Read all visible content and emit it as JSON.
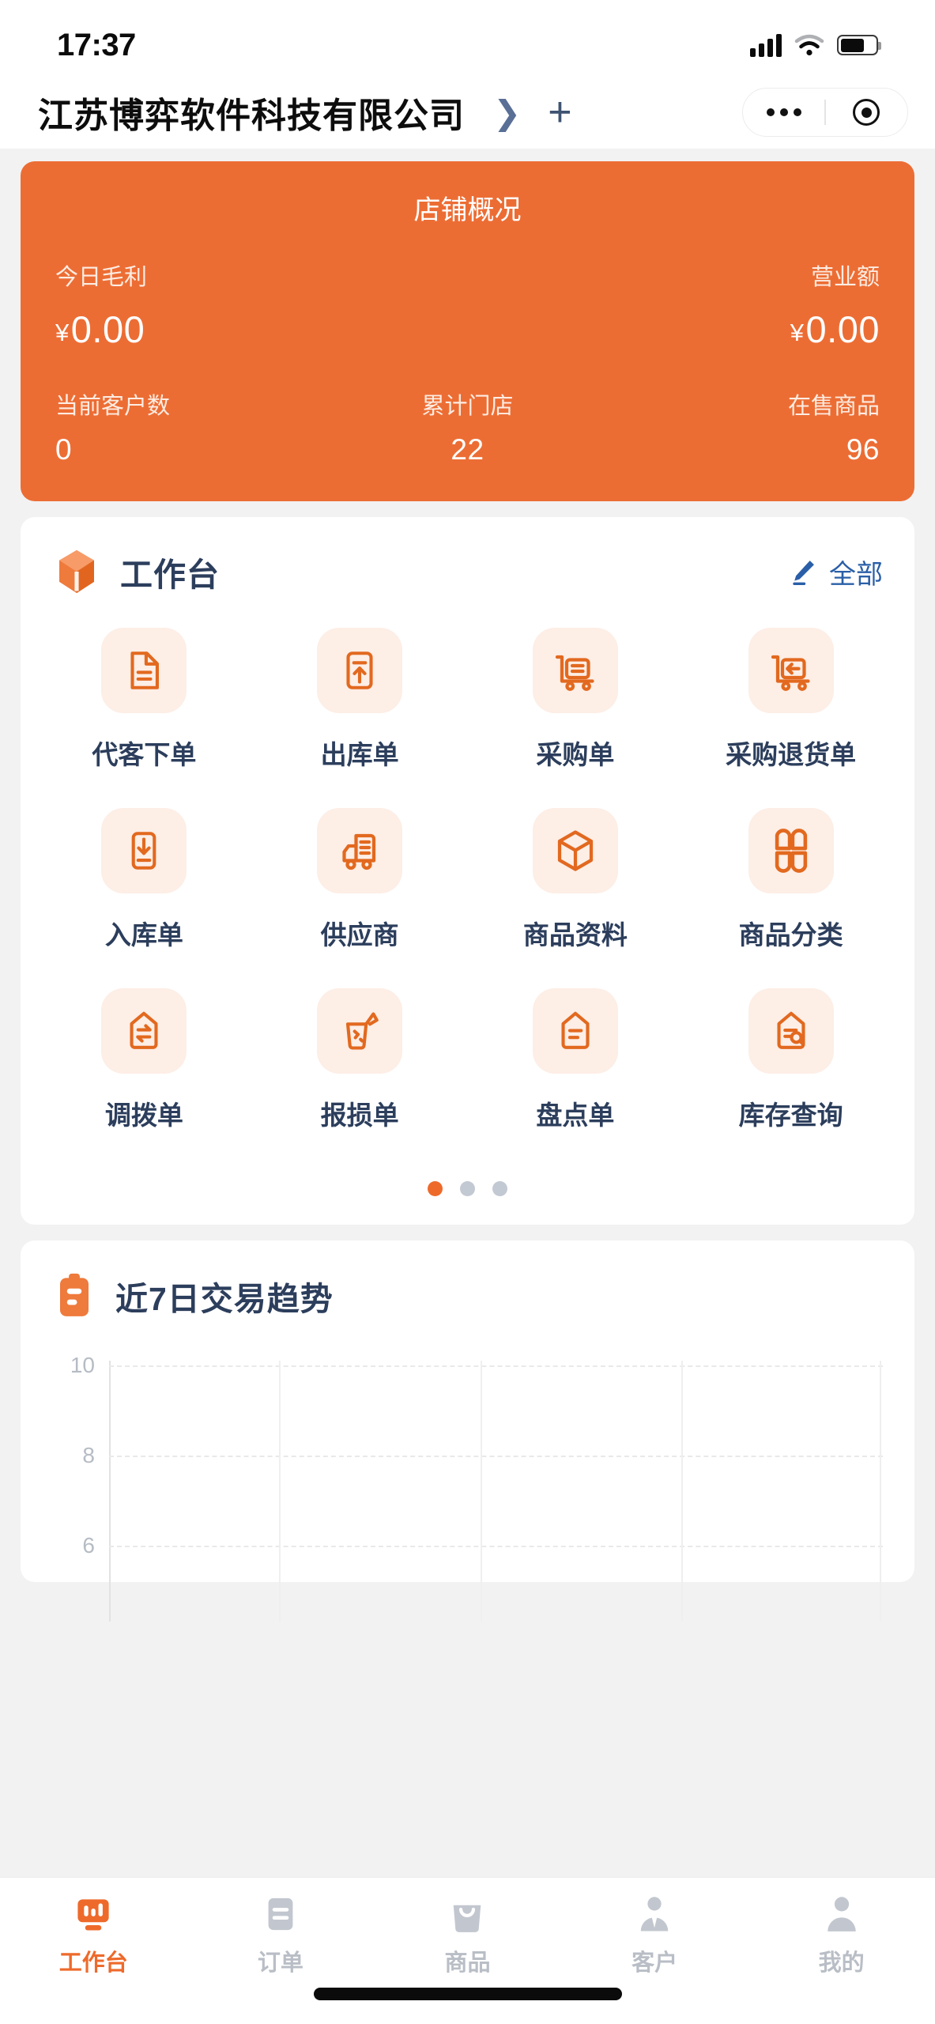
{
  "status_bar": {
    "time": "17:37",
    "signal_icon": "cellular-signal-icon",
    "wifi_icon": "wifi-icon",
    "battery_icon": "battery-icon"
  },
  "nav": {
    "title": "江苏博弈软件科技有限公司",
    "chevron_icon": "chevron-right-icon",
    "plus_icon": "plus-icon",
    "more_icon": "more-dots-icon",
    "target_icon": "target-circle-icon"
  },
  "summary": {
    "title": "店铺概况",
    "bg_color": "#ec6d34",
    "row1": [
      {
        "label": "今日毛利",
        "currency": "¥",
        "value": "0.00",
        "align": "left"
      },
      {
        "label": "",
        "currency": "",
        "value": "",
        "align": "mid"
      },
      {
        "label": "营业额",
        "currency": "¥",
        "value": "0.00",
        "align": "right"
      }
    ],
    "row2": [
      {
        "label": "当前客户数",
        "value": "0",
        "align": "left"
      },
      {
        "label": "累计门店",
        "value": "22",
        "align": "mid"
      },
      {
        "label": "在售商品",
        "value": "96",
        "align": "right"
      }
    ]
  },
  "workbench": {
    "icon": "package-box-icon",
    "title": "工作台",
    "all_link": {
      "icon": "pencil-edit-icon",
      "label": "全部",
      "color": "#2a5fa8"
    },
    "accent_color": "#e2691f",
    "bubble_color": "#fdeee6",
    "apps": [
      {
        "label": "代客下单",
        "icon": "document-lines-icon"
      },
      {
        "label": "出库单",
        "icon": "box-arrow-up-icon"
      },
      {
        "label": "采购单",
        "icon": "cart-document-icon"
      },
      {
        "label": "采购退货单",
        "icon": "cart-arrow-left-icon"
      },
      {
        "label": "入库单",
        "icon": "box-arrow-down-icon"
      },
      {
        "label": "供应商",
        "icon": "delivery-truck-icon"
      },
      {
        "label": "商品资料",
        "icon": "cube-3d-icon"
      },
      {
        "label": "商品分类",
        "icon": "four-petal-grid-icon"
      },
      {
        "label": "调拨单",
        "icon": "transfer-arrows-icon"
      },
      {
        "label": "报损单",
        "icon": "broken-cup-icon"
      },
      {
        "label": "盘点单",
        "icon": "clipboard-lines-icon"
      },
      {
        "label": "库存查询",
        "icon": "document-search-icon"
      }
    ],
    "pager": {
      "count": 3,
      "active_index": 0,
      "active_color": "#ee6a2b",
      "inactive_color": "#c2c9d2"
    }
  },
  "trend": {
    "icon": "clipboard-orange-icon",
    "title": "近7日交易趋势"
  },
  "chart_data": {
    "type": "line",
    "title": "近7日交易趋势",
    "xlabel": "",
    "ylabel": "",
    "x": [],
    "series": [],
    "values": [],
    "categories": [],
    "yticks": [
      10,
      8,
      6
    ],
    "ylim": [
      6,
      10
    ],
    "grid": true,
    "grid_style": "dashed",
    "legend": "none",
    "note": "图表区域为空，仅显示坐标轴与网格线"
  },
  "tabbar": {
    "active_color": "#ee6a2b",
    "inactive_color": "#b9bec6",
    "items": [
      {
        "label": "工作台",
        "icon": "bar-chart-icon",
        "active": true
      },
      {
        "label": "订单",
        "icon": "clipboard-icon",
        "active": false
      },
      {
        "label": "商品",
        "icon": "shopping-bag-icon",
        "active": false
      },
      {
        "label": "客户",
        "icon": "person-tie-icon",
        "active": false
      },
      {
        "label": "我的",
        "icon": "person-icon",
        "active": false
      }
    ]
  }
}
